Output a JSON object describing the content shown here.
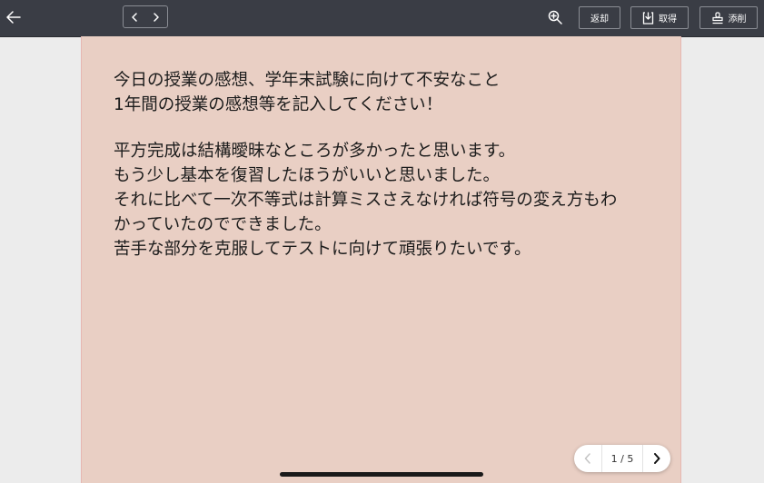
{
  "toolbar": {
    "return_label": "返却",
    "acquire_label": "取得",
    "correct_label": "添削"
  },
  "sheet": {
    "prompt_lines": [
      "今日の授業の感想、学年末試験に向けて不安なこと",
      "1年間の授業の感想等を記入してください！"
    ],
    "answer_lines": [
      "平方完成は結構曖昧なところが多かったと思います。",
      "もう少し基本を復習したほうがいいと思いました。",
      "それに比べて一次不等式は計算ミスさえなければ符号の変え方もわ",
      "かっていたのでできました。",
      "苦手な部分を克服してテストに向けて頑張りたいです。"
    ],
    "background_color": "#e9cfc4"
  },
  "pager": {
    "page_label": "1 / 5"
  },
  "icons": [
    "arrow-left-icon",
    "chevron-left-icon",
    "chevron-right-icon",
    "zoom-in-icon",
    "download-tray-icon",
    "stamp-icon"
  ]
}
